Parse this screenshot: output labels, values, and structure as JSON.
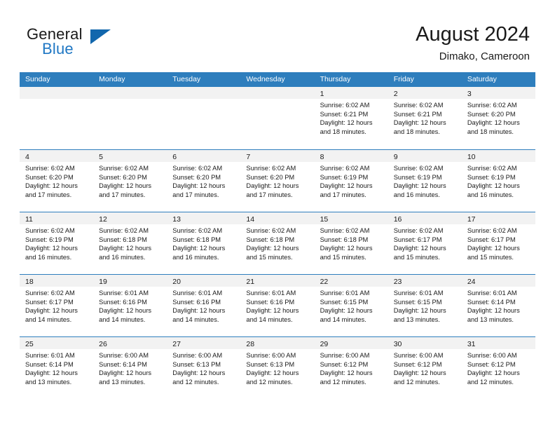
{
  "brand": {
    "word_top": "General",
    "word_bottom": "Blue",
    "flag_icon": "triangle-flag-icon",
    "accent_color": "#1267ad",
    "blue_text_color": "#1f77c4"
  },
  "header": {
    "title": "August 2024",
    "location": "Dimako, Cameroon"
  },
  "calendar": {
    "header_bg_color": "#2e7ebd",
    "day_band_color": "#f2f2f2",
    "weekdays": [
      "Sunday",
      "Monday",
      "Tuesday",
      "Wednesday",
      "Thursday",
      "Friday",
      "Saturday"
    ],
    "weeks": [
      [
        {
          "date": "",
          "empty": true,
          "sunrise": "",
          "sunset": "",
          "daylight_line1": "",
          "daylight_line2": ""
        },
        {
          "date": "",
          "empty": true,
          "sunrise": "",
          "sunset": "",
          "daylight_line1": "",
          "daylight_line2": ""
        },
        {
          "date": "",
          "empty": true,
          "sunrise": "",
          "sunset": "",
          "daylight_line1": "",
          "daylight_line2": ""
        },
        {
          "date": "",
          "empty": true,
          "sunrise": "",
          "sunset": "",
          "daylight_line1": "",
          "daylight_line2": ""
        },
        {
          "date": "1",
          "empty": false,
          "sunrise": "Sunrise: 6:02 AM",
          "sunset": "Sunset: 6:21 PM",
          "daylight_line1": "Daylight: 12 hours",
          "daylight_line2": "and 18 minutes."
        },
        {
          "date": "2",
          "empty": false,
          "sunrise": "Sunrise: 6:02 AM",
          "sunset": "Sunset: 6:21 PM",
          "daylight_line1": "Daylight: 12 hours",
          "daylight_line2": "and 18 minutes."
        },
        {
          "date": "3",
          "empty": false,
          "sunrise": "Sunrise: 6:02 AM",
          "sunset": "Sunset: 6:20 PM",
          "daylight_line1": "Daylight: 12 hours",
          "daylight_line2": "and 18 minutes."
        }
      ],
      [
        {
          "date": "4",
          "empty": false,
          "sunrise": "Sunrise: 6:02 AM",
          "sunset": "Sunset: 6:20 PM",
          "daylight_line1": "Daylight: 12 hours",
          "daylight_line2": "and 17 minutes."
        },
        {
          "date": "5",
          "empty": false,
          "sunrise": "Sunrise: 6:02 AM",
          "sunset": "Sunset: 6:20 PM",
          "daylight_line1": "Daylight: 12 hours",
          "daylight_line2": "and 17 minutes."
        },
        {
          "date": "6",
          "empty": false,
          "sunrise": "Sunrise: 6:02 AM",
          "sunset": "Sunset: 6:20 PM",
          "daylight_line1": "Daylight: 12 hours",
          "daylight_line2": "and 17 minutes."
        },
        {
          "date": "7",
          "empty": false,
          "sunrise": "Sunrise: 6:02 AM",
          "sunset": "Sunset: 6:20 PM",
          "daylight_line1": "Daylight: 12 hours",
          "daylight_line2": "and 17 minutes."
        },
        {
          "date": "8",
          "empty": false,
          "sunrise": "Sunrise: 6:02 AM",
          "sunset": "Sunset: 6:19 PM",
          "daylight_line1": "Daylight: 12 hours",
          "daylight_line2": "and 17 minutes."
        },
        {
          "date": "9",
          "empty": false,
          "sunrise": "Sunrise: 6:02 AM",
          "sunset": "Sunset: 6:19 PM",
          "daylight_line1": "Daylight: 12 hours",
          "daylight_line2": "and 16 minutes."
        },
        {
          "date": "10",
          "empty": false,
          "sunrise": "Sunrise: 6:02 AM",
          "sunset": "Sunset: 6:19 PM",
          "daylight_line1": "Daylight: 12 hours",
          "daylight_line2": "and 16 minutes."
        }
      ],
      [
        {
          "date": "11",
          "empty": false,
          "sunrise": "Sunrise: 6:02 AM",
          "sunset": "Sunset: 6:19 PM",
          "daylight_line1": "Daylight: 12 hours",
          "daylight_line2": "and 16 minutes."
        },
        {
          "date": "12",
          "empty": false,
          "sunrise": "Sunrise: 6:02 AM",
          "sunset": "Sunset: 6:18 PM",
          "daylight_line1": "Daylight: 12 hours",
          "daylight_line2": "and 16 minutes."
        },
        {
          "date": "13",
          "empty": false,
          "sunrise": "Sunrise: 6:02 AM",
          "sunset": "Sunset: 6:18 PM",
          "daylight_line1": "Daylight: 12 hours",
          "daylight_line2": "and 16 minutes."
        },
        {
          "date": "14",
          "empty": false,
          "sunrise": "Sunrise: 6:02 AM",
          "sunset": "Sunset: 6:18 PM",
          "daylight_line1": "Daylight: 12 hours",
          "daylight_line2": "and 15 minutes."
        },
        {
          "date": "15",
          "empty": false,
          "sunrise": "Sunrise: 6:02 AM",
          "sunset": "Sunset: 6:18 PM",
          "daylight_line1": "Daylight: 12 hours",
          "daylight_line2": "and 15 minutes."
        },
        {
          "date": "16",
          "empty": false,
          "sunrise": "Sunrise: 6:02 AM",
          "sunset": "Sunset: 6:17 PM",
          "daylight_line1": "Daylight: 12 hours",
          "daylight_line2": "and 15 minutes."
        },
        {
          "date": "17",
          "empty": false,
          "sunrise": "Sunrise: 6:02 AM",
          "sunset": "Sunset: 6:17 PM",
          "daylight_line1": "Daylight: 12 hours",
          "daylight_line2": "and 15 minutes."
        }
      ],
      [
        {
          "date": "18",
          "empty": false,
          "sunrise": "Sunrise: 6:02 AM",
          "sunset": "Sunset: 6:17 PM",
          "daylight_line1": "Daylight: 12 hours",
          "daylight_line2": "and 14 minutes."
        },
        {
          "date": "19",
          "empty": false,
          "sunrise": "Sunrise: 6:01 AM",
          "sunset": "Sunset: 6:16 PM",
          "daylight_line1": "Daylight: 12 hours",
          "daylight_line2": "and 14 minutes."
        },
        {
          "date": "20",
          "empty": false,
          "sunrise": "Sunrise: 6:01 AM",
          "sunset": "Sunset: 6:16 PM",
          "daylight_line1": "Daylight: 12 hours",
          "daylight_line2": "and 14 minutes."
        },
        {
          "date": "21",
          "empty": false,
          "sunrise": "Sunrise: 6:01 AM",
          "sunset": "Sunset: 6:16 PM",
          "daylight_line1": "Daylight: 12 hours",
          "daylight_line2": "and 14 minutes."
        },
        {
          "date": "22",
          "empty": false,
          "sunrise": "Sunrise: 6:01 AM",
          "sunset": "Sunset: 6:15 PM",
          "daylight_line1": "Daylight: 12 hours",
          "daylight_line2": "and 14 minutes."
        },
        {
          "date": "23",
          "empty": false,
          "sunrise": "Sunrise: 6:01 AM",
          "sunset": "Sunset: 6:15 PM",
          "daylight_line1": "Daylight: 12 hours",
          "daylight_line2": "and 13 minutes."
        },
        {
          "date": "24",
          "empty": false,
          "sunrise": "Sunrise: 6:01 AM",
          "sunset": "Sunset: 6:14 PM",
          "daylight_line1": "Daylight: 12 hours",
          "daylight_line2": "and 13 minutes."
        }
      ],
      [
        {
          "date": "25",
          "empty": false,
          "sunrise": "Sunrise: 6:01 AM",
          "sunset": "Sunset: 6:14 PM",
          "daylight_line1": "Daylight: 12 hours",
          "daylight_line2": "and 13 minutes."
        },
        {
          "date": "26",
          "empty": false,
          "sunrise": "Sunrise: 6:00 AM",
          "sunset": "Sunset: 6:14 PM",
          "daylight_line1": "Daylight: 12 hours",
          "daylight_line2": "and 13 minutes."
        },
        {
          "date": "27",
          "empty": false,
          "sunrise": "Sunrise: 6:00 AM",
          "sunset": "Sunset: 6:13 PM",
          "daylight_line1": "Daylight: 12 hours",
          "daylight_line2": "and 12 minutes."
        },
        {
          "date": "28",
          "empty": false,
          "sunrise": "Sunrise: 6:00 AM",
          "sunset": "Sunset: 6:13 PM",
          "daylight_line1": "Daylight: 12 hours",
          "daylight_line2": "and 12 minutes."
        },
        {
          "date": "29",
          "empty": false,
          "sunrise": "Sunrise: 6:00 AM",
          "sunset": "Sunset: 6:12 PM",
          "daylight_line1": "Daylight: 12 hours",
          "daylight_line2": "and 12 minutes."
        },
        {
          "date": "30",
          "empty": false,
          "sunrise": "Sunrise: 6:00 AM",
          "sunset": "Sunset: 6:12 PM",
          "daylight_line1": "Daylight: 12 hours",
          "daylight_line2": "and 12 minutes."
        },
        {
          "date": "31",
          "empty": false,
          "sunrise": "Sunrise: 6:00 AM",
          "sunset": "Sunset: 6:12 PM",
          "daylight_line1": "Daylight: 12 hours",
          "daylight_line2": "and 12 minutes."
        }
      ]
    ]
  }
}
